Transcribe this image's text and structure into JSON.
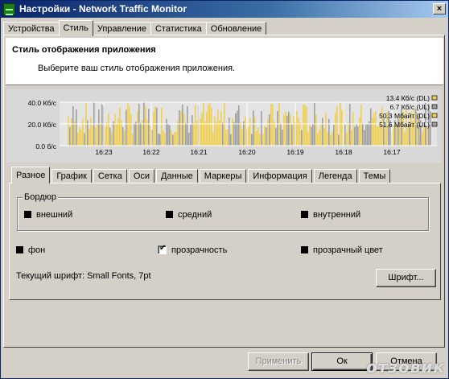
{
  "window": {
    "title": "Настройки - Network Traffic Monitor"
  },
  "tabs": [
    "Устройства",
    "Стиль",
    "Управление",
    "Статистика",
    "Обновление"
  ],
  "active_tab": 1,
  "header": {
    "title": "Стиль отображения приложения",
    "subtitle": "Выберите ваш стиль отображения приложения."
  },
  "graph": {
    "y_labels": [
      "40.0 Кб/с",
      "20.0 Кб/с",
      "0.0 б/с"
    ],
    "x_labels": [
      "16:23",
      "16:22",
      "16:21",
      "16:20",
      "16:19",
      "16:18",
      "16:17"
    ],
    "legend": [
      "13.4 Кб/с (DL)",
      "6.7 Кб/с (UL)",
      "50.3 Мбайт (DL)",
      "51.6 Мбайт (UL)"
    ],
    "colors": {
      "dl": "#f0d050",
      "ul": "#a0a0a0",
      "grid": "#ffffff",
      "bg": "#d8d8d8"
    }
  },
  "subtabs": [
    "Разное",
    "График",
    "Сетка",
    "Оси",
    "Данные",
    "Маркеры",
    "Информация",
    "Легенда",
    "Темы"
  ],
  "active_subtab": 0,
  "border_group": {
    "label": "Бордюр",
    "outer": "внешний",
    "middle": "средний",
    "inner": "внутренний"
  },
  "options": {
    "background": "фон",
    "transparency": "прозрачность",
    "transparent_color": "прозрачный цвет",
    "transparency_checked": true
  },
  "font": {
    "label": "Текущий шрифт: Small Fonts, 7pt",
    "button": "Шрифт..."
  },
  "buttons": {
    "apply": "Применить",
    "ok": "Ок",
    "cancel": "Отмена"
  },
  "watermark": "отзовик"
}
